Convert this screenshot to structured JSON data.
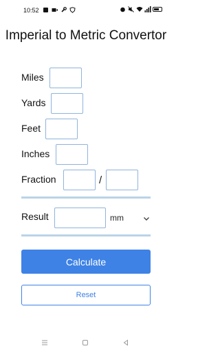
{
  "status_bar": {
    "time": "10:52",
    "left_icons": [
      "notification-icon",
      "video-icon",
      "wrench-icon",
      "shield-icon"
    ],
    "right_icons": [
      "alarm-icon",
      "mute-icon",
      "wifi-icon",
      "signal-icon",
      "battery-icon"
    ]
  },
  "title": "Imperial to Metric Convertor",
  "fields": {
    "miles": {
      "label": "Miles",
      "value": ""
    },
    "yards": {
      "label": "Yards",
      "value": ""
    },
    "feet": {
      "label": "Feet",
      "value": ""
    },
    "inches": {
      "label": "Inches",
      "value": ""
    },
    "fraction": {
      "label": "Fraction",
      "numerator": "",
      "separator": "/",
      "denominator": ""
    }
  },
  "result": {
    "label": "Result",
    "value": "",
    "unit": "mm"
  },
  "buttons": {
    "calculate": "Calculate",
    "reset": "Reset"
  },
  "nav": [
    "menu-icon",
    "home-icon",
    "back-icon"
  ],
  "colors": {
    "accent": "#3e82e6",
    "field_border": "#8fb3dc",
    "divider": "#b9d3e6"
  }
}
